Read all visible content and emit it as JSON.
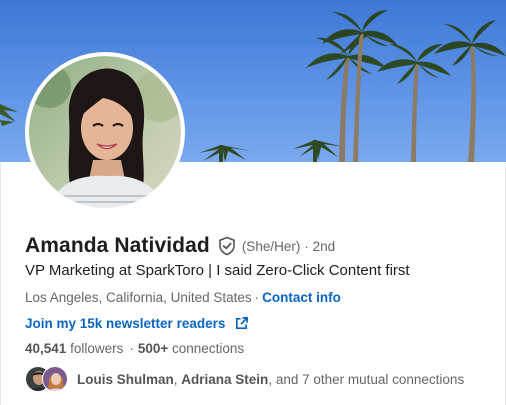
{
  "profile": {
    "name": "Amanda Natividad",
    "pronouns": "(She/Her)",
    "degree": "· 2nd",
    "headline": "VP Marketing at SparkToro | I said Zero-Click Content first",
    "location": "Los Angeles, California, United States",
    "contact_info": "Contact info",
    "newsletter_link": "Join my 15k newsletter readers",
    "followers_count": "40,541",
    "followers_label": "followers",
    "connections": "500+",
    "connections_label": "connections"
  },
  "mutual": {
    "person1": "Louis Shulman",
    "person2": "Adriana Stein",
    "rest": ", and 7 other mutual connections"
  },
  "colors": {
    "link": "#0a66c2",
    "text_primary": "#1d1d1d",
    "text_secondary": "#666666"
  },
  "icons": {
    "verified": "verified-shield-icon",
    "external": "external-link-icon"
  }
}
